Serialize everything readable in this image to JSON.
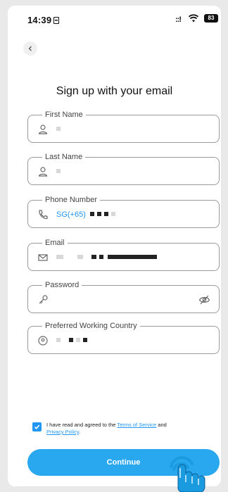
{
  "status": {
    "time": "14:39",
    "battery": "83",
    "signal": "::!"
  },
  "header": {
    "title": "Sign up with your email"
  },
  "fields": [
    {
      "label": "First Name",
      "icon": "person-icon"
    },
    {
      "label": "Last Name",
      "icon": "person-icon"
    },
    {
      "label": "Phone Number",
      "icon": "phone-icon",
      "prefix": "SG(+65)"
    },
    {
      "label": "Email",
      "icon": "mail-icon"
    },
    {
      "label": "Password",
      "icon": "key-icon"
    },
    {
      "label": "Preferred Working Country",
      "icon": "location-icon"
    }
  ],
  "agreement": {
    "text_before": "I have read and agreed to the ",
    "terms": "Terms of Service",
    "text_mid": " and ",
    "privacy": "Privacy Policy",
    "text_after": ".",
    "checked": true
  },
  "continue_label": "Continue",
  "colors": {
    "accent": "#2196f3",
    "button": "#29a8f0"
  }
}
